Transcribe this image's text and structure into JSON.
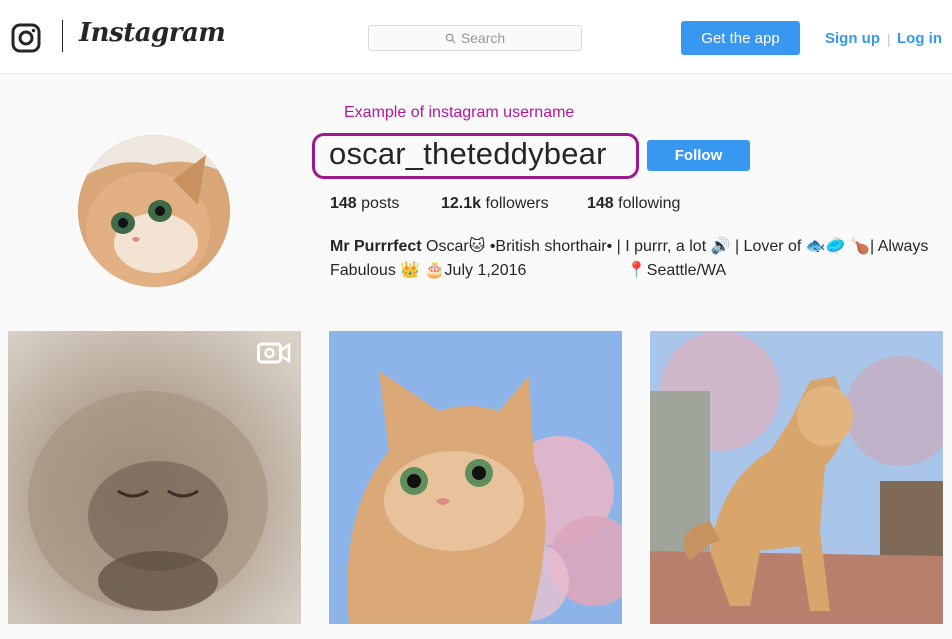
{
  "nav": {
    "wordmark": "Instagram",
    "search_placeholder": "Search",
    "get_app_label": "Get the app",
    "signup_label": "Sign up",
    "separator": "|",
    "login_label": "Log in"
  },
  "annotation": {
    "text": "Example of instagram username",
    "color": "#b3179f"
  },
  "profile": {
    "username": "oscar_theteddybear",
    "follow_label": "Follow",
    "stats": {
      "posts_count": "148",
      "posts_label": "posts",
      "followers_count": "12.1k",
      "followers_label": "followers",
      "following_count": "148",
      "following_label": "following"
    },
    "bio": {
      "name": "Mr Purrrfect",
      "line_1_rest": " Oscar🐱 •British shorthair• | I purrr, a lot 🔊 | Lover of 🐟🥏 🍗| Always",
      "line_2": "Fabulous 👑 🎂July 1,2016",
      "location": "📍Seattle/WA"
    }
  },
  "grid": {
    "tiles": [
      {
        "subject": "close-up of sleeping fluffy kitten",
        "media_icon": "video-camera-icon"
      },
      {
        "subject": "golden cat looking up under pink blossoms",
        "media_icon": ""
      },
      {
        "subject": "golden cat standing on wooden deck",
        "media_icon": ""
      }
    ]
  },
  "colors": {
    "accent_blue": "#3897f0",
    "annotation_border": "#9c1a90",
    "background": "#fafafa"
  }
}
